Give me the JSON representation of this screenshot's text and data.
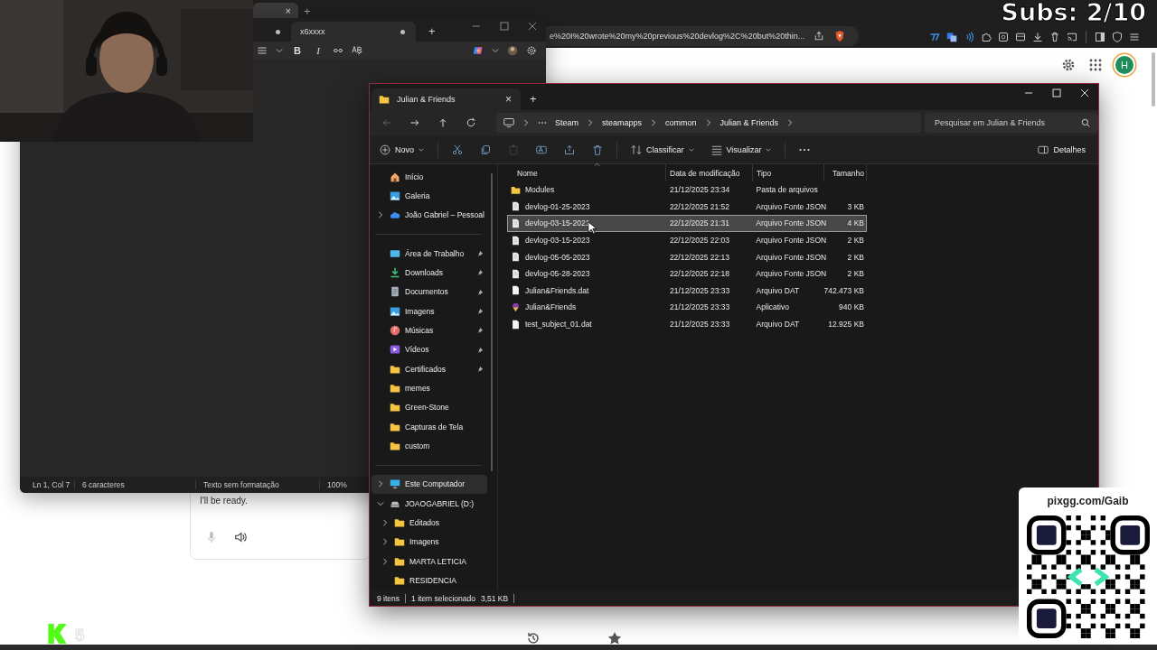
{
  "overlay": {
    "subs": "Subs: 2/10"
  },
  "browser": {
    "tab_close": "×",
    "new_tab": "+",
    "address": "e%20I%20wrote%20my%20previous%20devlog%2C%20but%20thin...",
    "avatar": "H",
    "reply": "I'll be ready."
  },
  "notepad": {
    "tabs": [
      {
        "selected": false,
        "unsaved": true
      },
      {
        "label": "x6xxxx",
        "selected": true,
        "unsaved": true
      }
    ],
    "new_tab": "+",
    "format": [
      "B",
      "I"
    ],
    "status": [
      "Ln 1, Col 7",
      "6 caracteres",
      "Texto sem formatação",
      "100%"
    ]
  },
  "explorer": {
    "tab": {
      "title": "Julian & Friends",
      "close": "×"
    },
    "new_tab": "+",
    "breadcrumb": [
      "Steam",
      "steamapps",
      "common",
      "Julian & Friends"
    ],
    "search": {
      "placeholder": "Pesquisar em Julian & Friends"
    },
    "toolbar": {
      "new": "Novo",
      "sort": "Classificar",
      "view": "Visualizar",
      "details": "Detalhes",
      "actions": [
        {
          "kind": "cut",
          "disabled": false
        },
        {
          "kind": "copy",
          "disabled": false
        },
        {
          "kind": "paste",
          "disabled": true
        },
        {
          "kind": "rename",
          "disabled": false
        },
        {
          "kind": "share",
          "disabled": false
        },
        {
          "kind": "delete",
          "disabled": false
        }
      ]
    },
    "sidebar": {
      "sections": [
        {
          "items": [
            {
              "label": "Início",
              "kind": "home",
              "selected": false
            },
            {
              "label": "Galeria",
              "kind": "gallery",
              "selected": false
            },
            {
              "label": "João Gabriel – Pessoal",
              "kind": "cloud",
              "selected": false,
              "expanded": false
            }
          ]
        },
        {
          "items": [
            {
              "label": "Área de Trabalho",
              "kind": "desktop",
              "selected": false,
              "pinned": true
            },
            {
              "label": "Downloads",
              "kind": "download",
              "selected": false,
              "pinned": true
            },
            {
              "label": "Documentos",
              "kind": "documents",
              "selected": false,
              "pinned": true
            },
            {
              "label": "Imagens",
              "kind": "images",
              "selected": false,
              "pinned": true
            },
            {
              "label": "Músicas",
              "kind": "music",
              "selected": false,
              "pinned": true
            },
            {
              "label": "Vídeos",
              "kind": "video",
              "selected": false,
              "pinned": true
            },
            {
              "label": "Certificados",
              "kind": "folder",
              "selected": false,
              "pinned": true
            },
            {
              "label": "memes",
              "kind": "folder",
              "selected": false,
              "pinned": false
            },
            {
              "label": "Green-Stone",
              "kind": "folder",
              "selected": false,
              "pinned": false
            },
            {
              "label": "Capturas de Tela",
              "kind": "folder",
              "selected": false,
              "pinned": false
            },
            {
              "label": "custom",
              "kind": "folder",
              "selected": false,
              "pinned": false
            }
          ]
        },
        {
          "items": [
            {
              "label": "Este Computador",
              "kind": "computer",
              "selected": true,
              "expanded": false
            },
            {
              "label": "JOAOGABRIEL (D:)",
              "kind": "drive",
              "selected": false,
              "expanded": true,
              "children": [
                {
                  "label": "Editados",
                  "kind": "folder",
                  "selected": false,
                  "expanded": false
                },
                {
                  "label": "Imagens",
                  "kind": "folder",
                  "selected": false,
                  "expanded": false
                },
                {
                  "label": "MARTA LETICIA",
                  "kind": "folder",
                  "selected": false,
                  "expanded": false
                },
                {
                  "label": "RESIDENCIA",
                  "kind": "folder",
                  "selected": false
                }
              ]
            }
          ]
        }
      ]
    },
    "columns": [
      "Nome",
      "Data de modificação",
      "Tipo",
      "Tamanho"
    ],
    "rows": [
      {
        "name": "Modules",
        "date": "21/12/2025 23:34",
        "type": "Pasta de arquivos",
        "kind": "folder",
        "selected": false
      },
      {
        "name": "devlog-01-25-2023",
        "date": "22/12/2025 21:52",
        "type": "Arquivo Fonte JSON",
        "size": "3 KB",
        "kind": "file",
        "selected": false
      },
      {
        "name": "devlog-03-15-2021",
        "date": "22/12/2025 21:31",
        "type": "Arquivo Fonte JSON",
        "size": "4 KB",
        "kind": "file",
        "selected": true
      },
      {
        "name": "devlog-03-15-2023",
        "date": "22/12/2025 22:03",
        "type": "Arquivo Fonte JSON",
        "size": "2 KB",
        "kind": "file",
        "selected": false
      },
      {
        "name": "devlog-05-05-2023",
        "date": "22/12/2025 22:13",
        "type": "Arquivo Fonte JSON",
        "size": "2 KB",
        "kind": "file",
        "selected": false
      },
      {
        "name": "devlog-05-28-2023",
        "date": "22/12/2025 22:18",
        "type": "Arquivo Fonte JSON",
        "size": "2 KB",
        "kind": "file",
        "selected": false
      },
      {
        "name": "Julian&Friends.dat",
        "date": "21/12/2025 23:33",
        "type": "Arquivo DAT",
        "size": "742.473 KB",
        "kind": "data",
        "selected": false
      },
      {
        "name": "Julian&Friends",
        "date": "21/12/2025 23:33",
        "type": "Aplicativo",
        "size": "940 KB",
        "kind": "app",
        "selected": false
      },
      {
        "name": "test_subject_01.dat",
        "date": "21/12/2025 23:33",
        "type": "Arquivo DAT",
        "size": "12.925 KB",
        "kind": "data",
        "selected": false
      }
    ],
    "status": {
      "count": "9 itens",
      "selection": "1 item selecionado",
      "size": "3,51 KB"
    }
  },
  "donation": {
    "url": "pixgg.com/Gaib"
  },
  "stream": {
    "count": "5"
  }
}
